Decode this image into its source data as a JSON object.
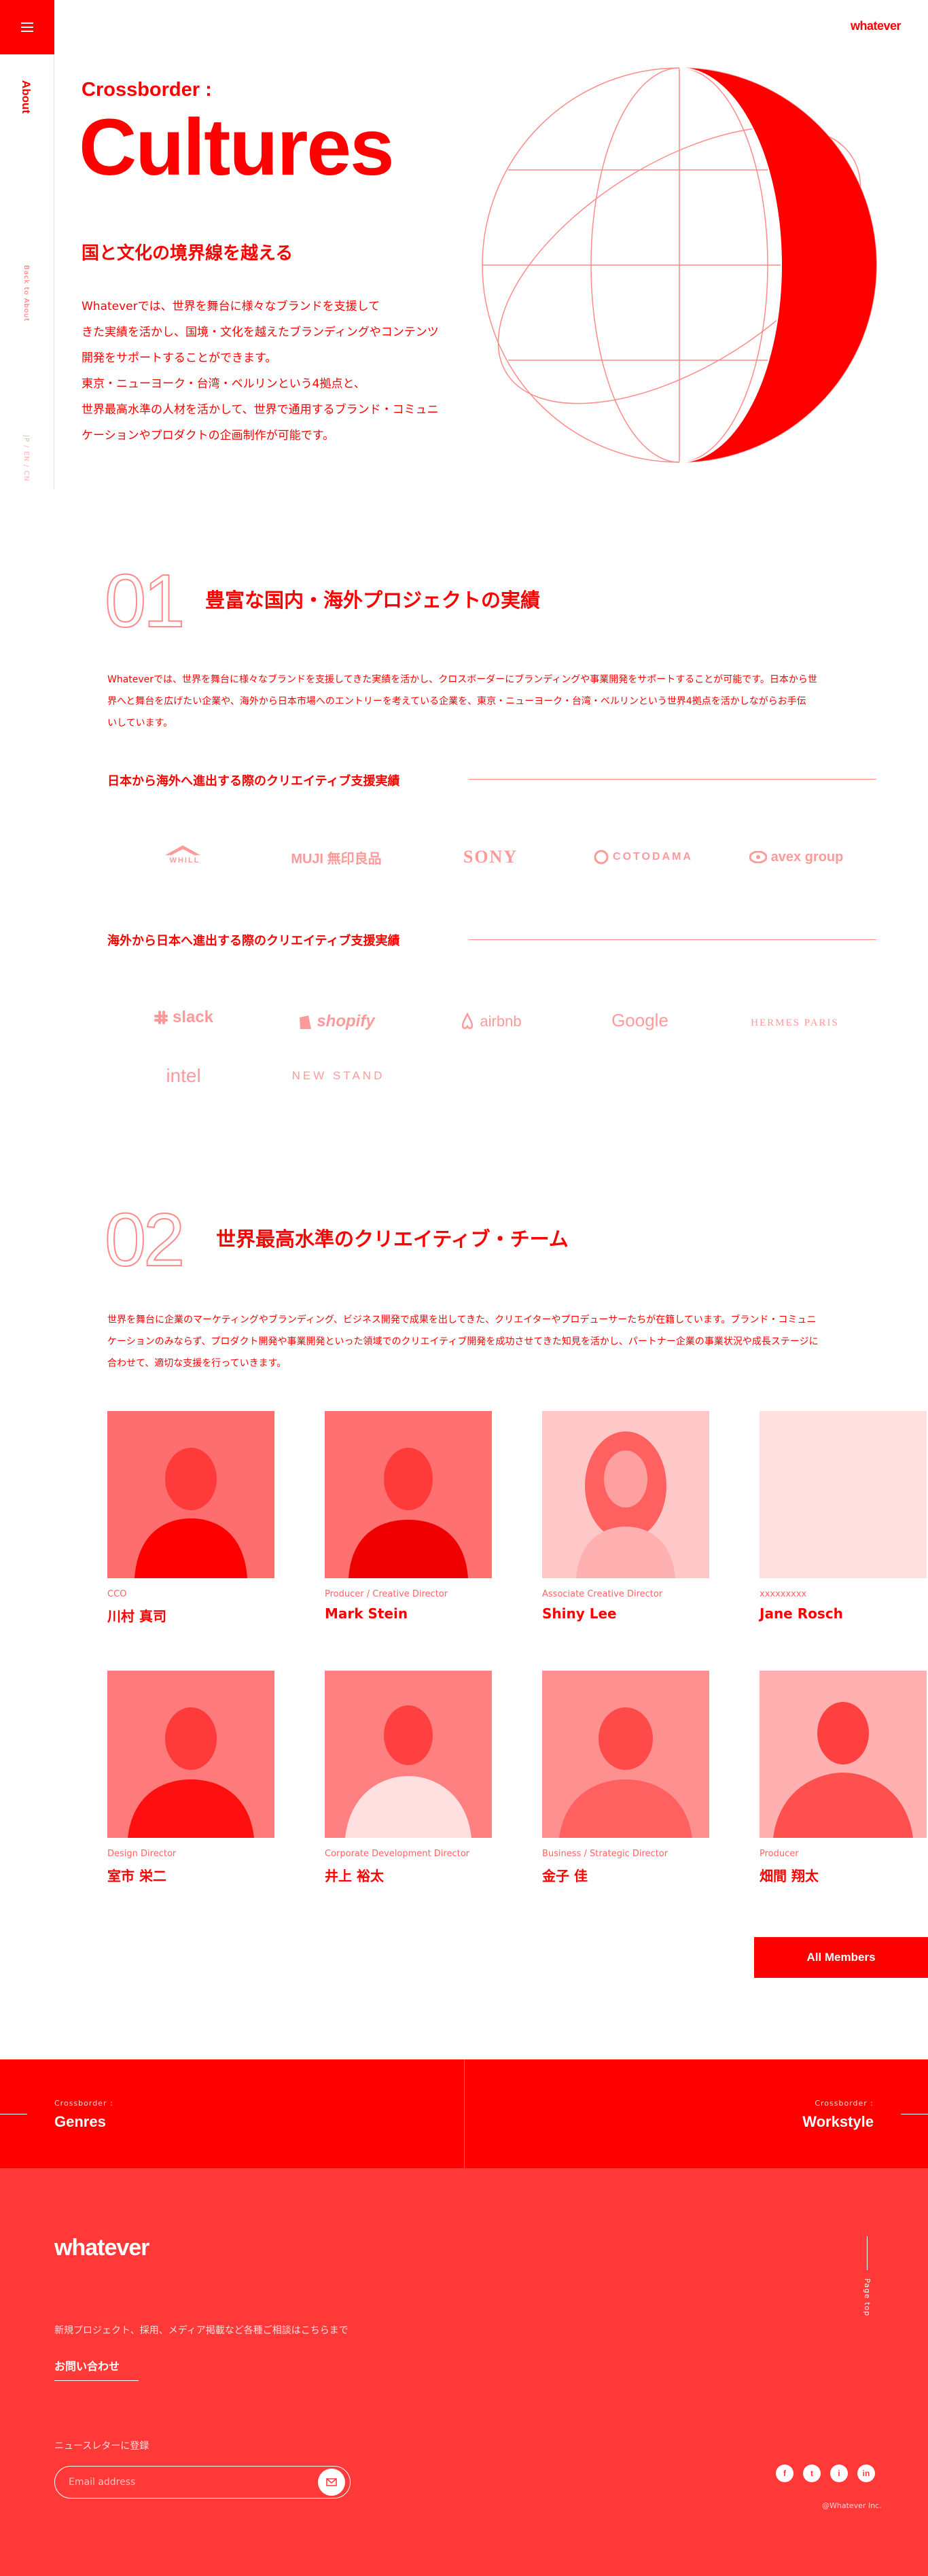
{
  "header": {
    "brand": "whatever"
  },
  "rail": {
    "about": "About",
    "back": "Back to About",
    "lang": "JP / EN / CN"
  },
  "hero": {
    "subtitle": "Crossborder :",
    "title": "Cultures",
    "lead": "国と文化の境界線を越える",
    "body": [
      "Whateverでは、世界を舞台に様々なブランドを支援して",
      "きた実績を活かし、国境・文化を越えたブランディングやコンテンツ",
      "開発をサポートすることができます。",
      "東京・ニューヨーク・台湾・ベルリンという4拠点と、",
      "世界最高水準の人材を活かして、世界で通用するブランド・コミュニ",
      "ケーションやプロダクトの企画制作が可能です。"
    ]
  },
  "section1": {
    "number": "01",
    "title": "豊富な国内・海外プロジェクトの実績",
    "body": [
      "Whateverでは、世界を舞台に様々なブランドを支援してきた実績を活かし、クロスボーダーにブランディングや事業開発をサポートすることが可能です。日本から世",
      "界へと舞台を広げたい企業や、海外から日本市場へのエントリーを考えている企業を、東京・ニューヨーク・台湾・ベルリンという世界4拠点を活かしながらお手伝",
      "いしています。"
    ],
    "outbound_heading": "日本から海外へ進出する際のクリエイティブ支援実績",
    "outbound_logos": [
      "WHILL",
      "MUJI 無印良品",
      "SONY",
      "COTODAMA",
      "avex group"
    ],
    "inbound_heading": "海外から日本へ進出する際のクリエイティブ支援実績",
    "inbound_logos": [
      "slack",
      "shopify",
      "airbnb",
      "Google",
      "HERMES PARIS",
      "intel",
      "NEW STAND"
    ]
  },
  "section2": {
    "number": "02",
    "title": "世界最高水準のクリエイティブ・チーム",
    "body": [
      "世界を舞台に企業のマーケティングやブランディング、ビジネス開発で成果を出してきた、クリエイターやプロデューサーたちが在籍しています。ブランド・コミュニ",
      "ケーションのみならず、プロダクト開発や事業開発といった領域でのクリエイティブ開発を成功させてきた知見を活かし、パートナー企業の事業状況や成長ステージに",
      "合わせて、適切な支援を行っていきます。"
    ],
    "members": [
      {
        "role": "CCO",
        "name": "川村 真司"
      },
      {
        "role": "Producer / Creative Director",
        "name": "Mark Stein"
      },
      {
        "role": "Associate Creative Director",
        "name": "Shiny Lee"
      },
      {
        "role": "xxxxxxxxx",
        "name": "Jane Rosch"
      },
      {
        "role": "Design Director",
        "name": "室市 栄二"
      },
      {
        "role": "Corporate Development Director",
        "name": "井上 裕太"
      },
      {
        "role": "Business / Strategic Director",
        "name": "金子 佳"
      },
      {
        "role": "Producer",
        "name": "畑間 翔太"
      }
    ],
    "all_members": "All Members"
  },
  "bottom_nav": {
    "left_small": "Crossborder :",
    "left_big": "Genres",
    "right_small": "Crossborder :",
    "right_big": "Workstyle"
  },
  "footer": {
    "brand": "whatever",
    "inquiry_text": "新規プロジェクト、採用、メディア掲載など各種ご相談はこちらまで",
    "contact": "お問い合わせ",
    "newsletter": "ニュースレターに登録",
    "email_placeholder": "Email address",
    "page_top": "Page top",
    "socials": [
      "f",
      "t",
      "i",
      "in"
    ],
    "copyright": "@Whatever Inc."
  },
  "colors": {
    "accent": "#ff0000",
    "footer": "#ff3838",
    "soft": "#ff8a8a"
  }
}
